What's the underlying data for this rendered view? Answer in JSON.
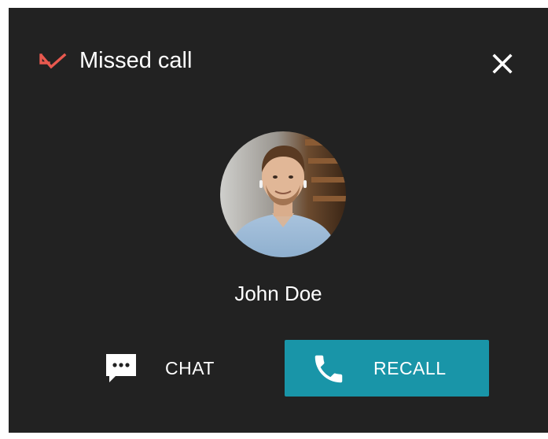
{
  "dialog": {
    "title": "Missed call",
    "title_icon": "missed-call-arrow-icon",
    "close_icon": "close-icon",
    "accent_color": "#e9594f"
  },
  "caller": {
    "name": "John Doe",
    "avatar": "avatar-photo"
  },
  "actions": {
    "chat_label": "CHAT",
    "chat_icon": "chat-bubble-icon",
    "recall_label": "RECALL",
    "recall_icon": "phone-icon",
    "recall_color": "#1995a8"
  },
  "colors": {
    "background": "#222222",
    "text": "#ffffff"
  }
}
